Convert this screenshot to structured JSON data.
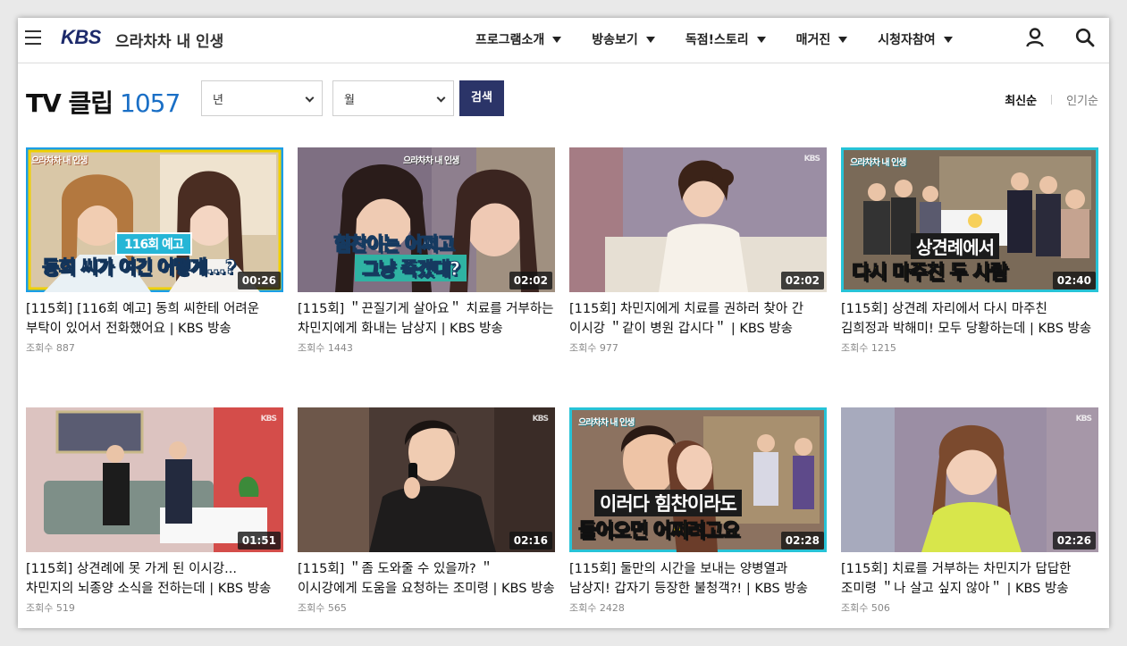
{
  "header": {
    "logo": "KBS",
    "program_title": "으라차차 내 인생",
    "nav": [
      "프로그램소개",
      "방송보기",
      "독점!스토리",
      "매거진",
      "시청자참여"
    ]
  },
  "toolbar": {
    "title": "TV 클립",
    "count": "1057",
    "year_placeholder": "년",
    "month_placeholder": "월",
    "search_label": "검색",
    "sort_latest": "최신순",
    "sort_popular": "인기순"
  },
  "clips": [
    {
      "title": "[115회] [116회 예고] 동희 씨한테 어려운 부탁이 있어서 전화했어요 | KBS 방송",
      "views": "조회수 887",
      "duration": "00:26",
      "caption_top": "116회 예고",
      "caption_main": "동희 씨가 여긴 어떻게...?"
    },
    {
      "title": "[115회] ＂끈질기게 살아요＂ 치료를 거부하는 차민지에게 화내는 남상지 | KBS 방송",
      "views": "조회수 1443",
      "duration": "02:02",
      "caption_top": "힘찬이는 어쩌고",
      "caption_main": "그냥 죽겠대?"
    },
    {
      "title": "[115회] 차민지에게 치료를 권하러 찾아 간 이시강 ＂같이 병원 갑시다＂ | KBS 방송",
      "views": "조회수 977",
      "duration": "02:02",
      "caption_top": "",
      "caption_main": ""
    },
    {
      "title": "[115회] 상견례 자리에서 다시 마주친 김희정과 박해미! 모두 당황하는데 | KBS 방송",
      "views": "조회수 1215",
      "duration": "02:40",
      "caption_top": "상견례에서",
      "caption_main": "다시 마주친 두 사람"
    },
    {
      "title": "[115회] 상견례에 못 가게 된 이시강... 차민지의 뇌종양 소식을 전하는데 | KBS 방송",
      "views": "조회수 519",
      "duration": "01:51",
      "caption_top": "",
      "caption_main": ""
    },
    {
      "title": "[115회] ＂좀 도와줄 수 있을까? ＂ 이시강에게 도움을 요청하는 조미령 | KBS 방송",
      "views": "조회수 565",
      "duration": "02:16",
      "caption_top": "",
      "caption_main": ""
    },
    {
      "title": "[115회] 둘만의 시간을 보내는 양병열과 남상지! 갑자기 등장한 불청객?! | KBS 방송",
      "views": "조회수 2428",
      "duration": "02:28",
      "caption_top": "이러다 힘찬이라도",
      "caption_main": "들어오면 어쩌려고요"
    },
    {
      "title": "[115회] 치료를 거부하는 차민지가 답답한 조미령 ＂나 살고 싶지 않아＂ | KBS 방송",
      "views": "조회수 506",
      "duration": "02:26",
      "caption_top": "",
      "caption_main": ""
    }
  ],
  "watermarks": [
    "으라차차 내 인생",
    "KBS"
  ],
  "colors": {
    "brand": "#1d2a6b",
    "accent": "#1a6fc6",
    "button": "#2b3468"
  }
}
